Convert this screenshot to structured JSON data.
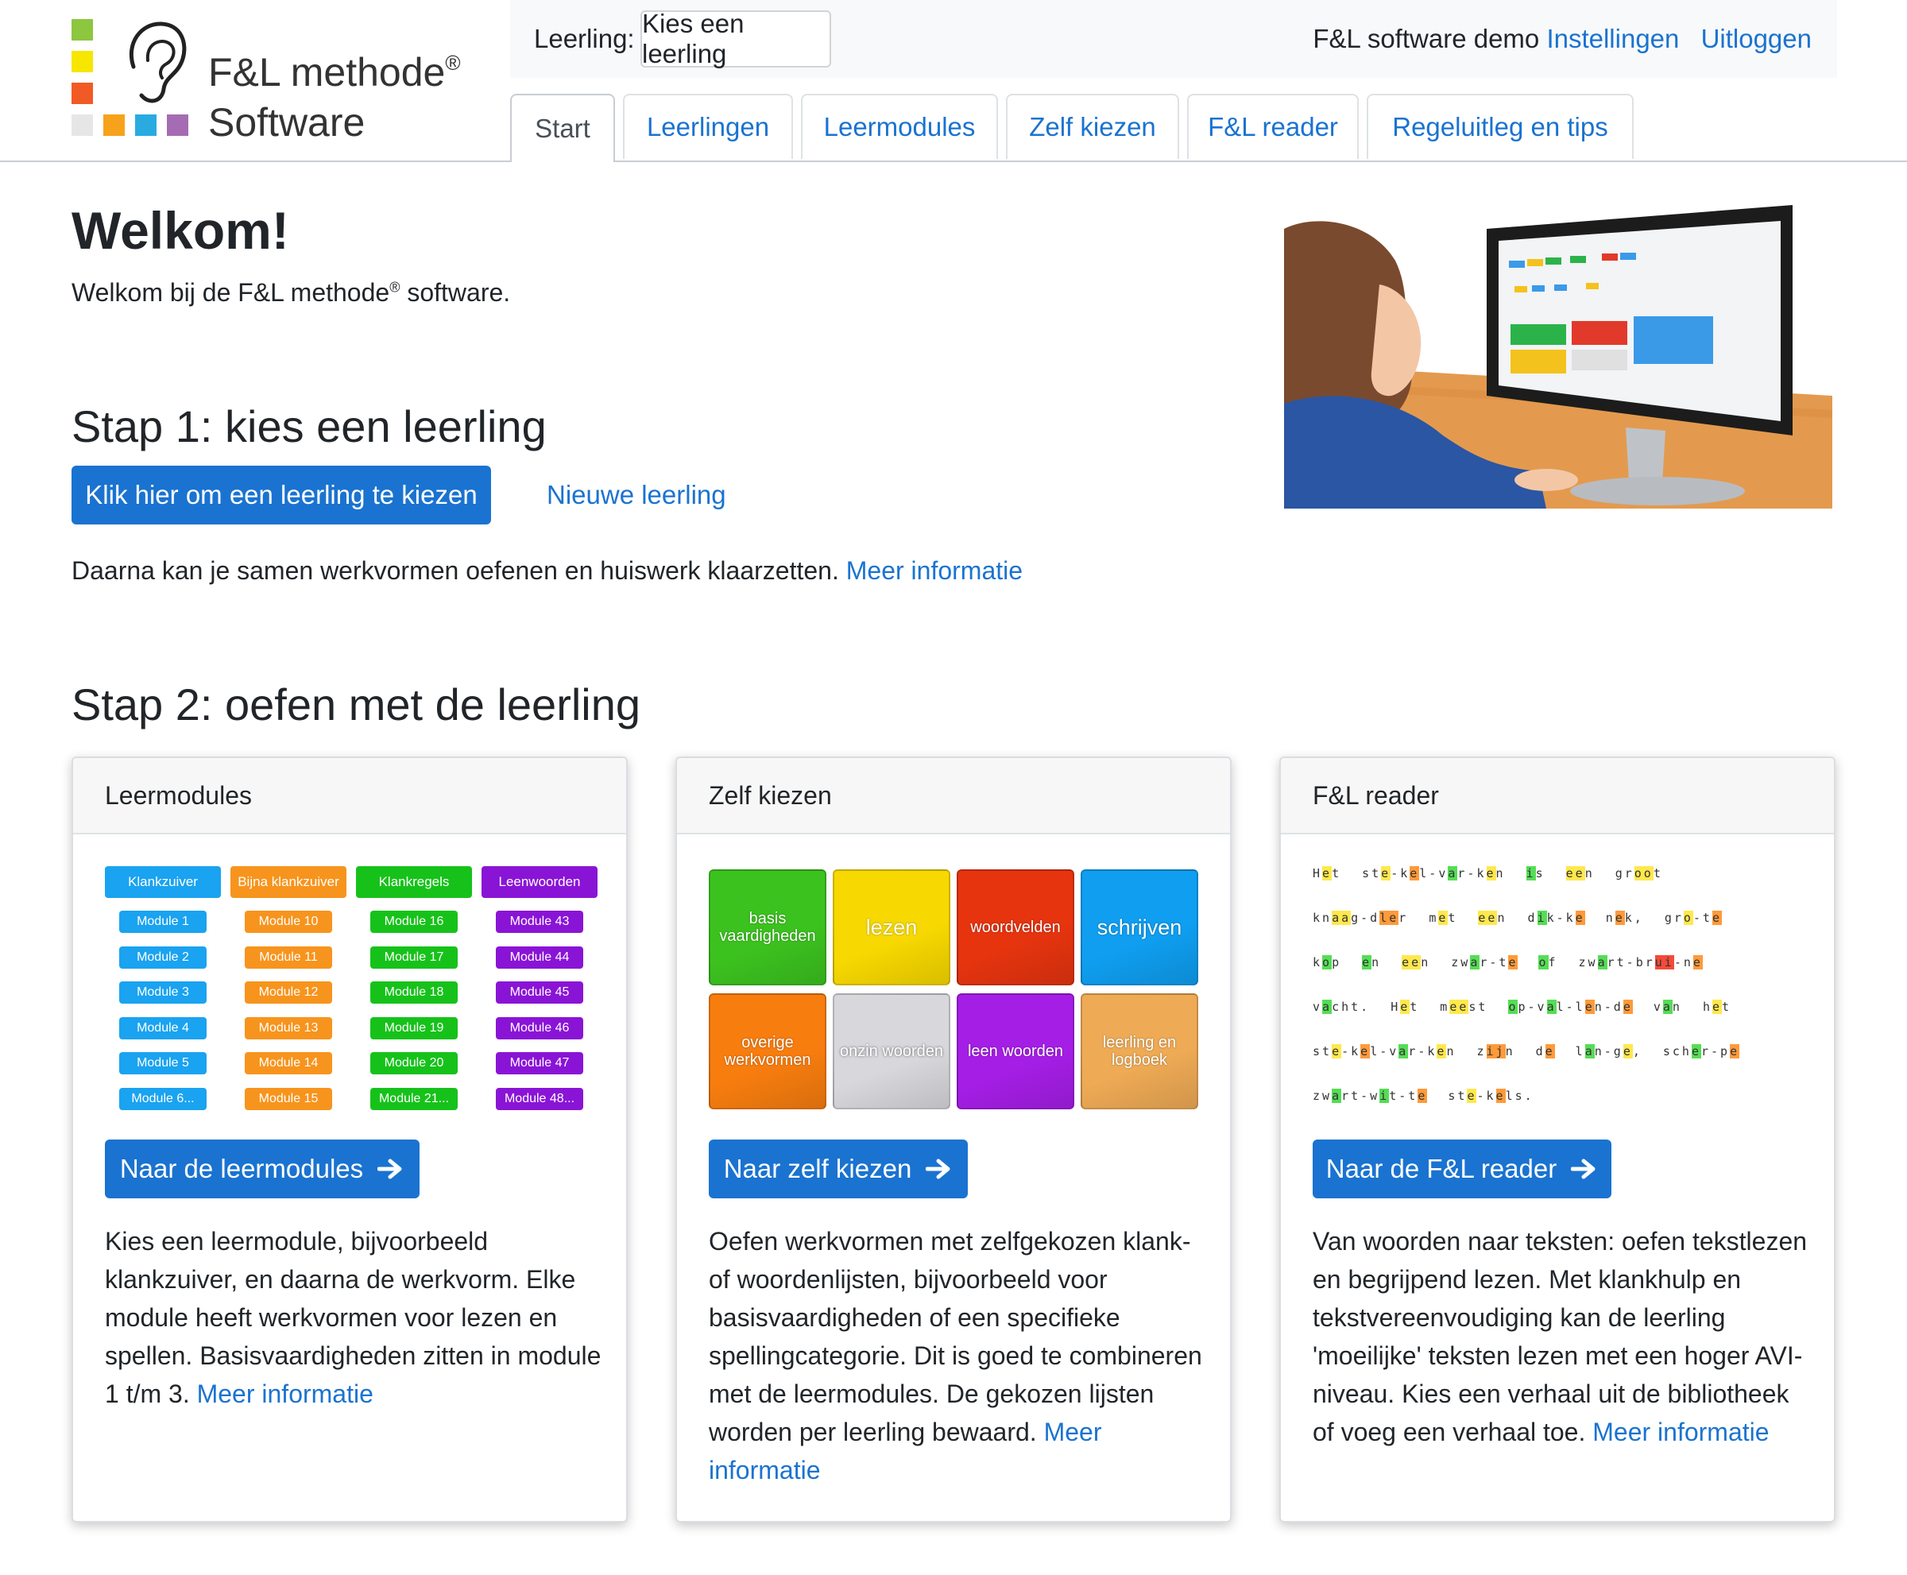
{
  "header": {
    "brand_line1": "F&L methode",
    "brand_reg": "®",
    "brand_line2": "Software",
    "leerling_label": "Leerling:",
    "leerling_picker": "Kies een leerling",
    "account": "F&L software demo",
    "settings": "Instellingen",
    "logout": "Uitloggen",
    "logo_colors": [
      "#8dc63f",
      "#f7e600",
      "#f15a24",
      "#e6e6e6",
      "#f7a21b",
      "#29abe2",
      "#a66cb3"
    ]
  },
  "tabs": [
    {
      "label": "Start",
      "active": true
    },
    {
      "label": "Leerlingen"
    },
    {
      "label": "Leermodules"
    },
    {
      "label": "Zelf kiezen"
    },
    {
      "label": "F&L reader"
    },
    {
      "label": "Regeluitleg en tips"
    }
  ],
  "welcome": {
    "title": "Welkom!",
    "text_pre": "Welkom bij de F&L methode",
    "text_reg": "®",
    "text_post": " software."
  },
  "step1": {
    "title": "Stap 1: kies een leerling",
    "button": "Klik hier om een leerling te kiezen",
    "new_link": "Nieuwe leerling",
    "text": "Daarna kan je samen werkvormen oefenen en huiswerk klaarzetten.",
    "more": "Meer informatie"
  },
  "step2": {
    "title": "Stap 2: oefen met de leerling",
    "cards": [
      {
        "header": "Leermodules",
        "button": "Naar de leermodules",
        "text": "Kies een leermodule, bijvoorbeeld klankzuiver, en daarna de werkvorm. Elke module heeft werkvormen voor lezen en spellen. Basisvaardigheden zitten in module 1 t/m 3.",
        "more": "Meer informatie"
      },
      {
        "header": "Zelf kiezen",
        "button": "Naar zelf kiezen",
        "text": "Oefen werkvormen met zelfgekozen klank- of woordenlijsten, bijvoorbeeld voor basisvaardigheden of een specifieke spellingcategorie. Dit is goed te combineren met de leermodules. De gekozen lijsten worden per leerling bewaard.",
        "more": "Meer informatie"
      },
      {
        "header": "F&L reader",
        "button": "Naar de F&L reader",
        "text": "Van woorden naar teksten: oefen tekstlezen en begrijpend lezen. Met klankhulp en tekstvereenvoudiging kan de leerling 'moeilijke' teksten lezen met een hoger AVI-niveau. Kies een verhaal uit de bibliotheek of voeg een verhaal toe.",
        "more": "Meer informatie"
      }
    ]
  },
  "modules": {
    "columns": [
      {
        "head": "Klankzuiver",
        "color": "#1aa3f0",
        "items": [
          "Module 1",
          "Module 2",
          "Module 3",
          "Module 4",
          "Module 5",
          "Module 6..."
        ]
      },
      {
        "head": "Bijna klankzuiver",
        "color": "#f7941d",
        "items": [
          "Module 10",
          "Module 11",
          "Module 12",
          "Module 13",
          "Module 14",
          "Module 15"
        ]
      },
      {
        "head": "Klankregels",
        "color": "#16c21a",
        "items": [
          "Module 16",
          "Module 17",
          "Module 18",
          "Module 19",
          "Module 20",
          "Module 21..."
        ]
      },
      {
        "head": "Leenwoorden",
        "color": "#8a14d6",
        "items": [
          "Module 43",
          "Module 44",
          "Module 45",
          "Module 46",
          "Module 47",
          "Module 48..."
        ]
      }
    ]
  },
  "tiles": [
    {
      "label": "basis vaardigheden",
      "color": "#3cc21f",
      "big": false
    },
    {
      "label": "lezen",
      "color": "#f7d800",
      "big": true
    },
    {
      "label": "woordvelden",
      "color": "#e6340f",
      "big": false
    },
    {
      "label": "schrijven",
      "color": "#0f9ef0",
      "big": true
    },
    {
      "label": "overige werkvormen",
      "color": "#f77d0f",
      "big": false
    },
    {
      "label": "onzin woorden",
      "color": "#d8d8dc",
      "big": false
    },
    {
      "label": "leen woorden",
      "color": "#a51ee6",
      "big": false
    },
    {
      "label": "leerling en logboek",
      "color": "#eeaa55",
      "big": false
    }
  ],
  "reader_lines": [
    [
      [
        "H",
        "",
        "e",
        "y",
        "t",
        ""
      ],
      [
        "st",
        "",
        "e",
        "y",
        "-k",
        "",
        "e",
        "o",
        "l-v",
        "",
        "a",
        "g",
        "r-k",
        "",
        "e",
        "y",
        "n",
        ""
      ],
      [
        "i",
        "g",
        "s",
        ""
      ],
      [
        "ee",
        "y",
        "n",
        ""
      ],
      [
        "gr",
        "",
        "oo",
        "y",
        "t",
        ""
      ]
    ],
    [
      [
        "kn",
        "",
        "aa",
        "y",
        "g-d",
        "",
        "le",
        "o",
        "r",
        ""
      ],
      [
        "m",
        "",
        "e",
        "y",
        "t",
        ""
      ],
      [
        "ee",
        "y",
        "n",
        ""
      ],
      [
        "d",
        "",
        "i",
        "g",
        "k-k",
        "",
        "e",
        "o",
        ""
      ],
      [
        "n",
        "",
        "e",
        "o",
        "k,",
        ""
      ],
      [
        "gr",
        "",
        "o",
        "y",
        "-t",
        "",
        "e",
        "o",
        ""
      ]
    ],
    [
      [
        "k",
        "",
        "o",
        "g",
        "p",
        ""
      ],
      [
        "e",
        "g",
        "n",
        ""
      ],
      [
        "ee",
        "y",
        "n",
        ""
      ],
      [
        "zw",
        "",
        "a",
        "g",
        "r-t",
        "",
        "e",
        "o",
        ""
      ],
      [
        "o",
        "g",
        "f",
        ""
      ],
      [
        "zw",
        "",
        "a",
        "g",
        "rt-br",
        "",
        "ui",
        "r",
        "-n",
        "",
        "e",
        "o",
        ""
      ]
    ],
    [
      [
        "v",
        "",
        "a",
        "g",
        "cht.",
        ""
      ],
      [
        "H",
        "",
        "e",
        "y",
        "t",
        ""
      ],
      [
        "m",
        "",
        "ee",
        "y",
        "st",
        ""
      ],
      [
        "o",
        "g",
        "p-v",
        "",
        "a",
        "g",
        "l-l",
        "",
        "e",
        "o",
        "n-d",
        "",
        "e",
        "o",
        ""
      ],
      [
        "v",
        "",
        "a",
        "g",
        "n",
        ""
      ],
      [
        "h",
        "",
        "e",
        "y",
        "t",
        ""
      ]
    ],
    [
      [
        "st",
        "",
        "e",
        "y",
        "-k",
        "",
        "e",
        "o",
        "l-v",
        "",
        "a",
        "g",
        "r-k",
        "",
        "e",
        "y",
        "n",
        ""
      ],
      [
        "z",
        "",
        "ij",
        "o",
        "n",
        ""
      ],
      [
        "d",
        "",
        "e",
        "o",
        ""
      ],
      [
        "l",
        "",
        "a",
        "g",
        "n-g",
        "",
        "e",
        "y",
        ","
      ],
      [
        "sch",
        "",
        "e",
        "g",
        "r-p",
        "",
        "e",
        "o",
        ""
      ]
    ],
    [
      [
        "zw",
        "",
        "a",
        "g",
        "rt-w",
        "",
        "i",
        "g",
        "t-t",
        "",
        "e",
        "o",
        ""
      ],
      [
        "st",
        "",
        "e",
        "y",
        "-k",
        "",
        "e",
        "o",
        "ls.",
        ""
      ]
    ]
  ]
}
